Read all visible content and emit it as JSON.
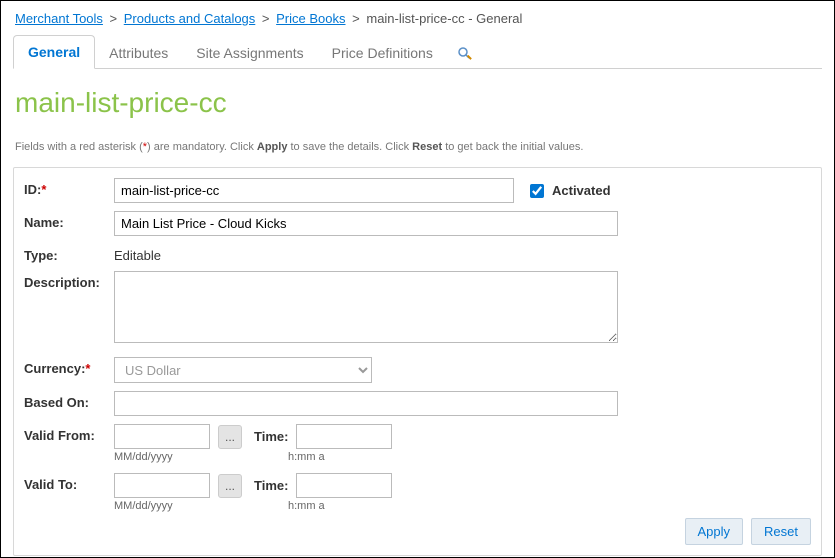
{
  "breadcrumb": {
    "items": [
      {
        "label": "Merchant Tools",
        "link": true
      },
      {
        "label": "Products and Catalogs",
        "link": true
      },
      {
        "label": "Price Books",
        "link": true
      },
      {
        "label": "main-list-price-cc - General",
        "link": false
      }
    ]
  },
  "tabs": {
    "general": "General",
    "attributes": "Attributes",
    "site_assignments": "Site Assignments",
    "price_definitions": "Price Definitions"
  },
  "page_title": "main-list-price-cc",
  "helper": {
    "prefix": "Fields with a red asterisk (",
    "asterisk": "*",
    "mid": ") are mandatory. Click ",
    "apply": "Apply",
    "mid2": " to save the details. Click ",
    "reset": "Reset",
    "suffix": " to get back the initial values."
  },
  "form": {
    "id_label": "ID:",
    "id_value": "main-list-price-cc",
    "activated_label": "Activated",
    "activated_checked": true,
    "name_label": "Name:",
    "name_value": "Main List Price - Cloud Kicks",
    "type_label": "Type:",
    "type_value": "Editable",
    "description_label": "Description:",
    "description_value": "",
    "currency_label": "Currency:",
    "currency_value": "US Dollar",
    "basedon_label": "Based On:",
    "basedon_value": "",
    "validfrom_label": "Valid From:",
    "validto_label": "Valid To:",
    "time_label": "Time:",
    "picker_label": "...",
    "date_hint": "MM/dd/yyyy",
    "time_hint": "h:mm a"
  },
  "buttons": {
    "apply": "Apply",
    "reset": "Reset"
  }
}
